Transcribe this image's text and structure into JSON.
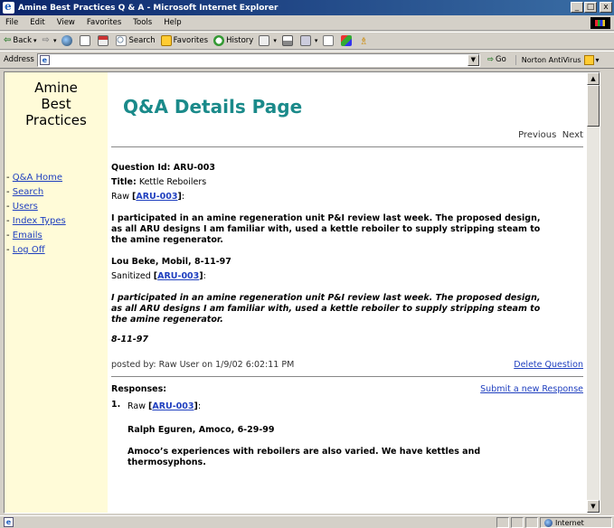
{
  "window": {
    "title": "Amine Best Practices Q & A - Microsoft Internet Explorer"
  },
  "window_buttons": [
    "_",
    "□",
    "x"
  ],
  "menu": [
    "File",
    "Edit",
    "View",
    "Favorites",
    "Tools",
    "Help"
  ],
  "toolbar": {
    "back": "Back",
    "search": "Search",
    "favorites": "Favorites",
    "history": "History"
  },
  "address": {
    "label": "Address",
    "value": "",
    "go": "Go",
    "norton": "Norton AntiVirus"
  },
  "sidebar": {
    "title_lines": [
      "Amine",
      "Best",
      "Practices"
    ],
    "nav": [
      "Q&A Home",
      "Search",
      "Users",
      "Index Types",
      "Emails",
      "Log Off"
    ]
  },
  "page": {
    "title": "Q&A Details Page",
    "previous": "Previous",
    "next": "Next",
    "question_id_label": "Question Id: ARU-003",
    "title_label": "Title:",
    "title_value": "Kettle Reboilers",
    "raw_label": "Raw",
    "raw_link": "ARU-003",
    "raw_text": "I participated in an amine regeneration unit P&I review last week.  The proposed design, as all ARU designs I am familiar with, used a kettle reboiler to supply stripping steam to the amine regenerator.",
    "raw_author": "Lou Beke, Mobil, 8-11-97",
    "sanitized_label": "Sanitized",
    "sanitized_link": "ARU-003",
    "sanitized_text": "I participated in an amine regeneration unit P&I review last week.  The proposed design, as all ARU designs I am familiar with, used a kettle reboiler to supply stripping steam to the amine regenerator.",
    "sanitized_date": "8-11-97",
    "posted_by": "posted by: Raw User on 1/9/02 6:02:11 PM",
    "delete": "Delete Question",
    "responses_label": "Responses:",
    "submit_response": "Submit a new Response",
    "responses": [
      {
        "num": "1.",
        "raw_label": "Raw",
        "raw_link": "ARU-003",
        "author": "Ralph Eguren, Amoco, 6-29-99",
        "text": "Amoco’s experiences with reboilers are also varied.  We have kettles and thermosyphons."
      }
    ]
  },
  "status": {
    "zone": "Internet"
  }
}
